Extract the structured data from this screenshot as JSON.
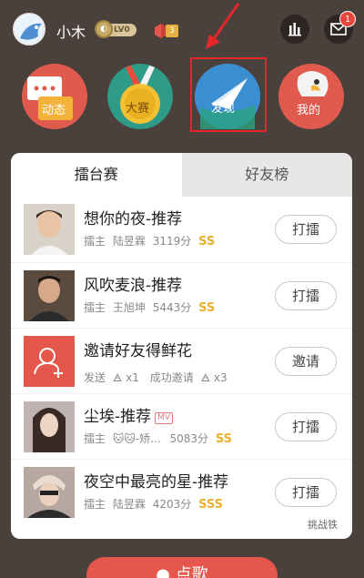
{
  "header": {
    "username": "小木",
    "level": "LV0",
    "gift_count": "3",
    "mail_badge": "1"
  },
  "nav": {
    "items": [
      {
        "label": "动态",
        "icon": "chat-bubble-icon"
      },
      {
        "label": "大赛",
        "icon": "medal-icon"
      },
      {
        "label": "发现",
        "icon": "paper-plane-icon"
      },
      {
        "label": "我的",
        "icon": "parrot-icon"
      }
    ]
  },
  "tabs": [
    {
      "label": "擂台赛",
      "active": true
    },
    {
      "label": "好友榜",
      "active": false
    }
  ],
  "rows": [
    {
      "title": "想你的夜-推荐",
      "meta_role": "擂主",
      "meta_name": "陆昱霖",
      "score": "3119分",
      "grade": "SS",
      "action": "打擂"
    },
    {
      "title": "风吹麦浪-推荐",
      "meta_role": "擂主",
      "meta_name": "王旭坤",
      "score": "5443分",
      "grade": "SS",
      "action": "打擂"
    },
    {
      "title": "邀请好友得鲜花",
      "meta_role": "发送",
      "meta_name": "x1",
      "meta_extra": "成功邀请",
      "meta_extra2": "x3",
      "action": "邀请"
    },
    {
      "title": "尘埃-推荐",
      "mv": "MV",
      "meta_role": "擂主",
      "meta_name": "🐱🐱-矫...",
      "score": "5083分",
      "grade": "SS",
      "action": "打擂"
    },
    {
      "title": "夜空中最亮的星-推荐",
      "meta_role": "擂主",
      "meta_name": "陆昱霖",
      "score": "4203分",
      "grade": "SSS",
      "action": "打擂"
    }
  ],
  "footer_link": "挑战铁",
  "bottom_button": "点歌",
  "colors": {
    "background": "#4a403c",
    "accent": "#e5574a",
    "grade": "#e8b12d",
    "highlight": "#e5262a"
  }
}
